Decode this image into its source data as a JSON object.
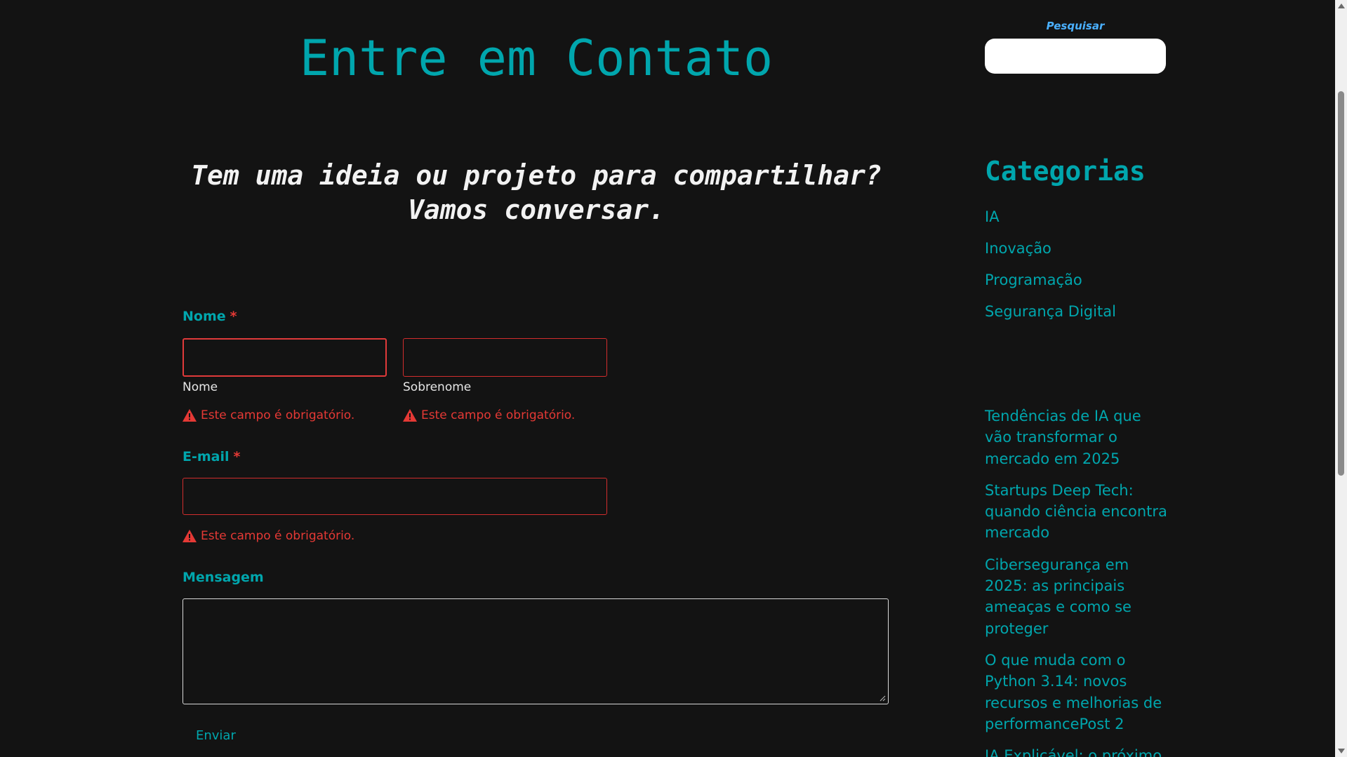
{
  "page": {
    "title": "Entre em Contato",
    "subtitle_line1": "Tem uma ideia ou projeto para compartilhar?",
    "subtitle_line2": "Vamos conversar."
  },
  "form": {
    "name_label": "Nome",
    "required_mark": "*",
    "first_name_sublabel": "Nome",
    "last_name_sublabel": "Sobrenome",
    "error_required": "Este campo é obrigatório.",
    "email_label": "E-mail",
    "message_label": "Mensagem",
    "submit_label": "Enviar"
  },
  "sidebar": {
    "search_label": "Pesquisar",
    "categories_heading": "Categorias",
    "categories": [
      "IA",
      "Inovação",
      "Programação",
      "Segurança Digital"
    ],
    "recent_posts": [
      "Tendências de IA que vão transformar o mercado em 2025",
      "Startups Deep Tech: quando ciência encontra mercado",
      "Cibersegurança em 2025: as principais ameaças e como se proteger",
      "O que muda com o Python 3.14: novos recursos e melhorias de performancePost 2",
      "IA Explicável: o próximo"
    ]
  },
  "colors": {
    "background": "#131313",
    "accent": "#00a6ad",
    "error": "#e53935",
    "search_label": "#4ab0ff"
  }
}
